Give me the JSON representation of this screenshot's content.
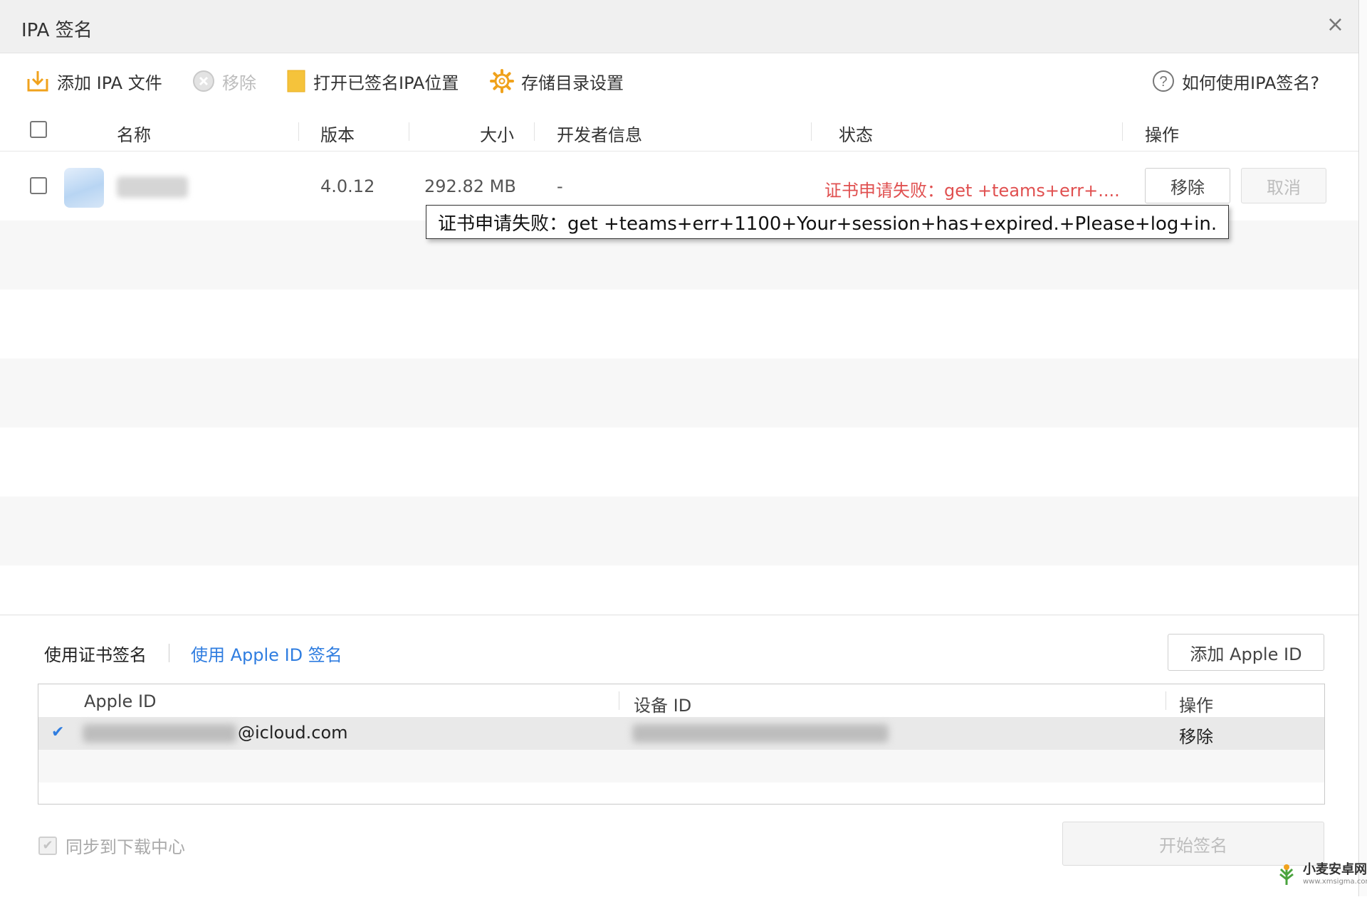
{
  "window": {
    "title": "IPA 签名",
    "close_glyph": "×"
  },
  "toolbar": {
    "add_ipa": "添加 IPA 文件",
    "remove": "移除",
    "open_signed": "打开已签名IPA位置",
    "storage_settings": "存储目录设置",
    "help": "如何使用IPA签名?"
  },
  "table": {
    "headers": {
      "name": "名称",
      "version": "版本",
      "size": "大小",
      "developer": "开发者信息",
      "status": "状态",
      "actions": "操作"
    },
    "rows": [
      {
        "version": "4.0.12",
        "size": "292.82 MB",
        "developer": "-",
        "status": "证书申请失败：get +teams+err+....",
        "remove_label": "移除",
        "cancel_label": "取消"
      }
    ]
  },
  "tooltip": {
    "text": "证书申请失败：get +teams+err+1100+Your+session+has+expired.+Please+log+in."
  },
  "signing": {
    "tab_cert": "使用证书签名",
    "tab_appleid": "使用 Apple ID 签名",
    "add_apple_id": "添加 Apple ID",
    "headers": {
      "apple_id": "Apple ID",
      "device_id": "设备 ID",
      "actions": "操作"
    },
    "accounts": [
      {
        "checkmark": "✔",
        "apple_id_suffix": "@icloud.com",
        "remove_label": "移除"
      }
    ],
    "sync_label": "同步到下载中心",
    "start_label": "开始签名"
  },
  "watermark": {
    "title": "小麦安卓网",
    "url": "www.xmsigma.com"
  },
  "colors": {
    "error": "#e05050",
    "link": "#2f7de0",
    "checkmark": "#2f7de0",
    "folder": "#f5c33b"
  }
}
